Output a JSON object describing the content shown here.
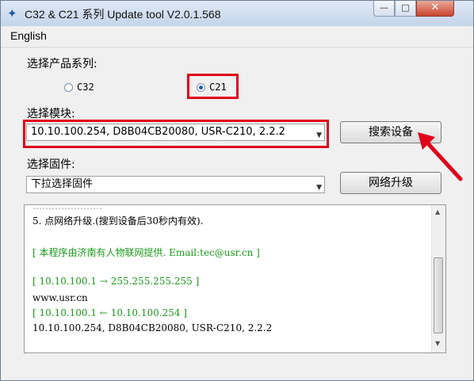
{
  "window": {
    "title": "C32 & C21 系列 Update tool V2.0.1.568",
    "minimize": "—",
    "maximize": "□",
    "close": "✕"
  },
  "menu": {
    "items": [
      "English"
    ]
  },
  "product": {
    "label": "选择产品系列:",
    "options": [
      {
        "label": "C32",
        "selected": false
      },
      {
        "label": "C21",
        "selected": true
      }
    ]
  },
  "module": {
    "label": "选择模块:",
    "selected": "10.10.100.254, D8B04CB20080, USR-C210, 2.2.2",
    "search_button": "搜索设备"
  },
  "firmware": {
    "label": "选择固件:",
    "selected": "下拉选择固件",
    "upgrade_button": "网络升级"
  },
  "log": {
    "lines": [
      {
        "text": "5. 点网络升级.(搜到设备后30秒内有效).",
        "color": "black"
      },
      {
        "text": "[ 本程序由济南有人物联网提供.   Email:tec@usr.cn ]",
        "color": "green"
      },
      {
        "text": "[ 10.10.100.1 → 255.255.255.255 ]",
        "color": "green"
      },
      {
        "text": "www.usr.cn",
        "color": "black"
      },
      {
        "text": "[ 10.10.100.1 ← 10.10.100.254 ]",
        "color": "green"
      },
      {
        "text": "10.10.100.254, D8B04CB20080, USR-C210, 2.2.2",
        "color": "black"
      }
    ]
  },
  "colors": {
    "highlight": "#e0001b",
    "green_text": "#1a9a1a"
  }
}
